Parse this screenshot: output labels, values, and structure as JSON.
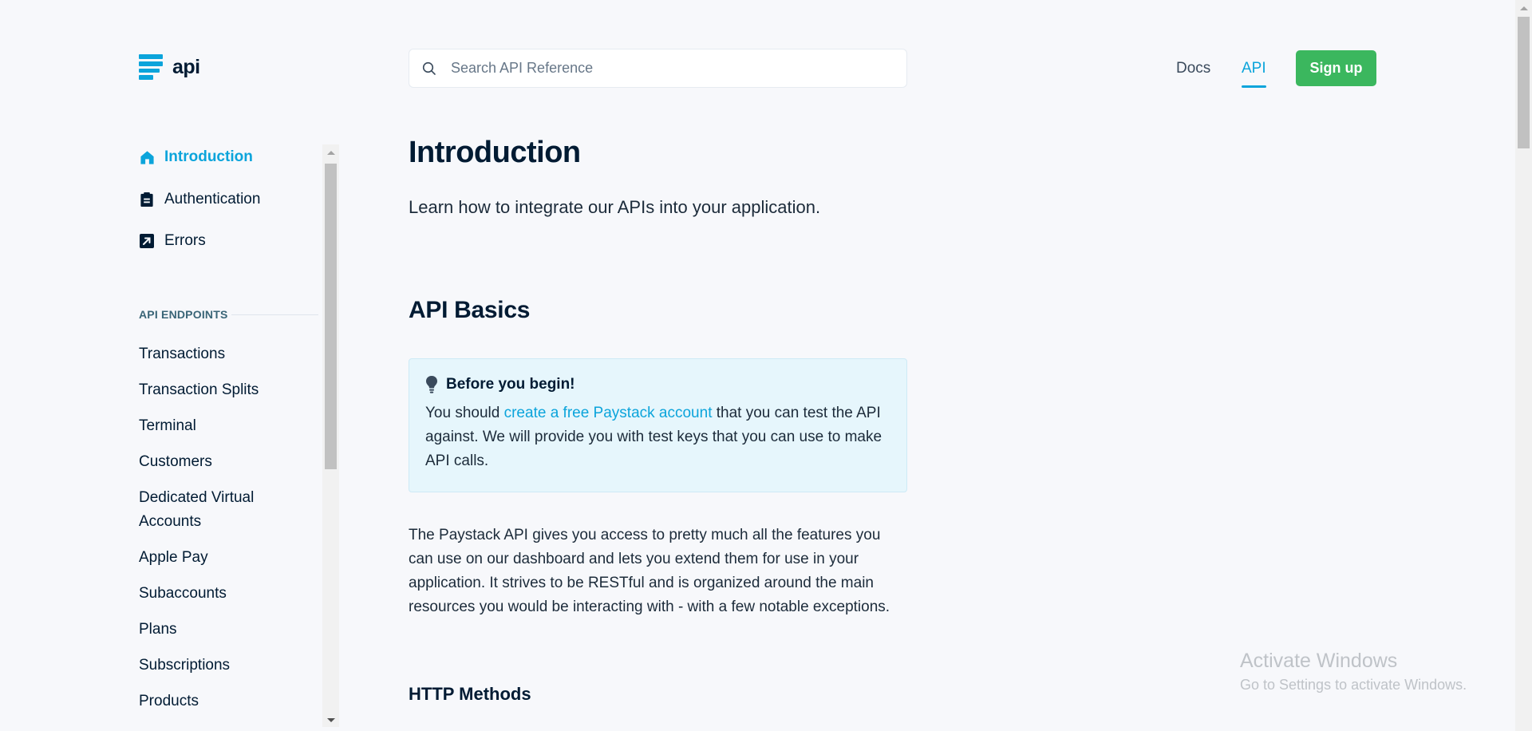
{
  "header": {
    "logo_text": "api",
    "search_placeholder": "Search API Reference",
    "nav": {
      "docs": "Docs",
      "api": "API"
    },
    "signup_label": "Sign up"
  },
  "sidebar": {
    "top_items": [
      {
        "label": "Introduction",
        "icon": "home-icon",
        "active": true
      },
      {
        "label": "Authentication",
        "icon": "clipboard-icon",
        "active": false
      },
      {
        "label": "Errors",
        "icon": "arrow-box-icon",
        "active": false
      }
    ],
    "section_label": "API ENDPOINTS",
    "endpoints": [
      "Transactions",
      "Transaction Splits",
      "Terminal",
      "Customers",
      "Dedicated Virtual Accounts",
      "Apple Pay",
      "Subaccounts",
      "Plans",
      "Subscriptions",
      "Products"
    ]
  },
  "main": {
    "title": "Introduction",
    "lead": "Learn how to integrate our APIs into your application.",
    "section_title": "API Basics",
    "callout": {
      "title": "Before you begin!",
      "text_before": "You should ",
      "link": "create a free Paystack account",
      "text_after": " that you can test the API against. We will provide you with test keys that you can use to make API calls."
    },
    "paragraph": "The Paystack API gives you access to pretty much all the features you can use on our dashboard and lets you extend them for use in your application. It strives to be RESTful and is organized around the main resources you would be interacting with - with a few notable exceptions.",
    "subsection_title": "HTTP Methods"
  },
  "watermark": {
    "title": "Activate Windows",
    "subtitle": "Go to Settings to activate Windows."
  },
  "colors": {
    "accent": "#0ba4db",
    "signup": "#3bb75e",
    "text": "#011b33",
    "background": "#f7f8fb",
    "callout_bg": "#e6f6fc"
  }
}
